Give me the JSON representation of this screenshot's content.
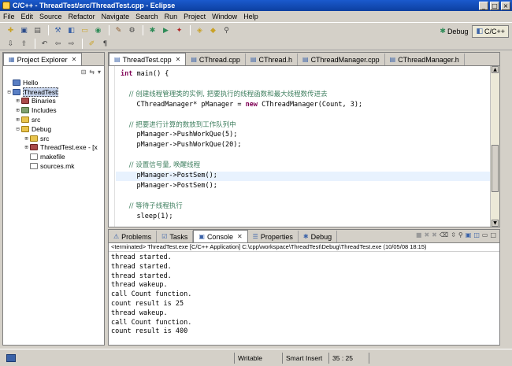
{
  "window": {
    "title": "C/C++ - ThreadTest/src/ThreadTest.cpp - Eclipse",
    "controls": [
      "_",
      "□",
      "×"
    ]
  },
  "menu": [
    "File",
    "Edit",
    "Source",
    "Refactor",
    "Navigate",
    "Search",
    "Run",
    "Project",
    "Window",
    "Help"
  ],
  "toolbar": {
    "perspectives": [
      {
        "label": "Debug",
        "icon": "debug-perspective-icon"
      },
      {
        "label": "C/C++",
        "icon": "cpp-perspective-icon"
      }
    ]
  },
  "explorer": {
    "tab_label": "Project Explorer",
    "tree": [
      {
        "label": "Hello",
        "level": 0,
        "expander": "",
        "icon": "project"
      },
      {
        "label": "ThreadTest",
        "level": 0,
        "expander": "−",
        "icon": "project",
        "selected": true
      },
      {
        "label": "Binaries",
        "level": 1,
        "expander": "+",
        "icon": "bin"
      },
      {
        "label": "Includes",
        "level": 1,
        "expander": "+",
        "icon": "inc"
      },
      {
        "label": "src",
        "level": 1,
        "expander": "+",
        "icon": "folder"
      },
      {
        "label": "Debug",
        "level": 1,
        "expander": "−",
        "icon": "folder"
      },
      {
        "label": "src",
        "level": 2,
        "expander": "+",
        "icon": "folder"
      },
      {
        "label": "ThreadTest.exe - [x",
        "level": 2,
        "expander": "+",
        "icon": "bin"
      },
      {
        "label": "makefile",
        "level": 2,
        "expander": "",
        "icon": "file"
      },
      {
        "label": "sources.mk",
        "level": 2,
        "expander": "",
        "icon": "file"
      }
    ]
  },
  "editor": {
    "tabs": [
      "ThreadTest.cpp",
      "CThread.cpp",
      "CThread.h",
      "CThreadManager.cpp",
      "CThreadManager.h"
    ],
    "lines": [
      {
        "text": "int main() {",
        "style": "main"
      },
      {
        "text": "",
        "style": "plain"
      },
      {
        "text": "    // 创建线程管理类的实例, 把要执行的线程函数和最大线程数传进去",
        "style": "comment"
      },
      {
        "text": "    CThreadManager* pManager = new CThreadManager(Count, 3);",
        "style": "new"
      },
      {
        "text": "",
        "style": "plain"
      },
      {
        "text": "    // 把要进行计算的数放到工作队列中",
        "style": "comment"
      },
      {
        "text": "    pManager->PushWorkQue(5);",
        "style": "plain"
      },
      {
        "text": "    pManager->PushWorkQue(20);",
        "style": "plain"
      },
      {
        "text": "",
        "style": "plain"
      },
      {
        "text": "    // 设置信号量, 唤醒线程",
        "style": "comment"
      },
      {
        "text": "    pManager->PostSem();",
        "style": "highlight"
      },
      {
        "text": "    pManager->PostSem();",
        "style": "plain"
      },
      {
        "text": "",
        "style": "plain"
      },
      {
        "text": "    // 等待子线程执行",
        "style": "comment"
      },
      {
        "text": "    sleep(1);",
        "style": "plain"
      }
    ]
  },
  "console": {
    "tabs": [
      "Problems",
      "Tasks",
      "Console",
      "Properties",
      "Debug"
    ],
    "active_tab": "Console",
    "description": "<terminated> ThreadTest.exe [C/C++ Application] C:\\cpp\\workspace\\ThreadTest\\Debug\\ThreadTest.exe (10/05/08 18:15)",
    "output": [
      "thread started.",
      "thread started.",
      "thread started.",
      "thread wakeup.",
      "call Count function.",
      "count result is 25",
      "thread wakeup.",
      "call Count function.",
      "count result is 400"
    ]
  },
  "status": {
    "writable": "Writable",
    "insert_mode": "Smart Insert",
    "position": "35 : 25"
  },
  "colors": {
    "title_bar": "#0d3fa0",
    "keyword": "#7f0055",
    "comment": "#3f7f5f",
    "line_highlight": "#e8f2fe"
  }
}
